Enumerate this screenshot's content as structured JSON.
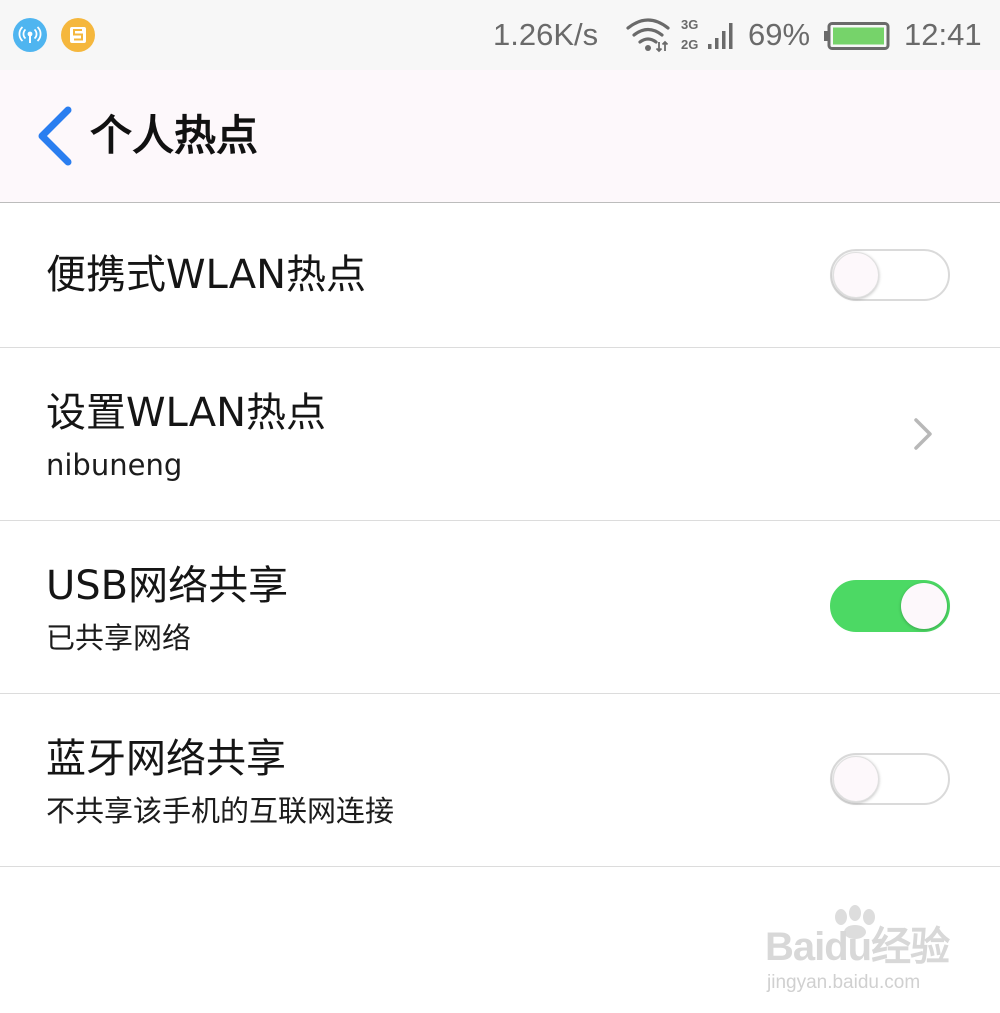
{
  "status_bar": {
    "speed": "1.26K/s",
    "network_types": [
      "3G",
      "2G"
    ],
    "battery_percent": "69%",
    "battery_level": 0.69,
    "time": "12:41",
    "icons": [
      "hotspot-icon",
      "app-notification-icon",
      "wifi-icon",
      "signal-icon",
      "battery-icon"
    ]
  },
  "header": {
    "title": "个人热点",
    "back_icon": "chevron-left-icon"
  },
  "settings": [
    {
      "title": "便携式WLAN热点",
      "subtitle": "",
      "control": "toggle",
      "on": false
    },
    {
      "title": "设置WLAN热点",
      "subtitle": "nibuneng",
      "control": "chevron"
    },
    {
      "title": "USB网络共享",
      "subtitle": "已共享网络",
      "control": "toggle",
      "on": true
    },
    {
      "title": "蓝牙网络共享",
      "subtitle": "不共享该手机的互联网连接",
      "control": "toggle",
      "on": false
    }
  ],
  "colors": {
    "accent": "#2a7ef0",
    "toggle_on": "#4cd964",
    "header_bg": "#fdf8fb",
    "status_bar_bg": "#f7f7f7"
  },
  "watermark": {
    "logo_text": "Baidu经验",
    "url": "jingyan.baidu.com"
  }
}
